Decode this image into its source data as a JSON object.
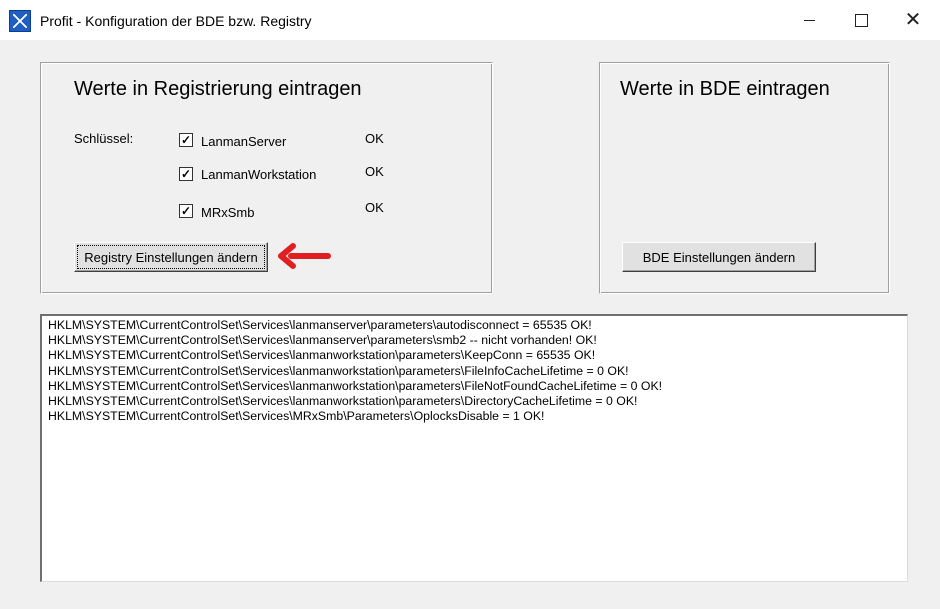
{
  "window": {
    "title": "Profit - Konfiguration der BDE bzw. Registry",
    "minimize_symbol": "—",
    "maximize_symbol": "☐",
    "close_symbol": "✕"
  },
  "registry_group": {
    "title": "Werte in Registrierung eintragen",
    "key_label": "Schlüssel:",
    "keys": [
      {
        "label": "LanmanServer",
        "checked": true,
        "status": "OK"
      },
      {
        "label": "LanmanWorkstation",
        "checked": true,
        "status": "OK"
      },
      {
        "label": "MRxSmb",
        "checked": true,
        "status": "OK"
      }
    ],
    "button_label": "Registry Einstellungen ändern"
  },
  "bde_group": {
    "title": "Werte in BDE eintragen",
    "button_label": "BDE Einstellungen ändern"
  },
  "log": {
    "lines": [
      "HKLM\\SYSTEM\\CurrentControlSet\\Services\\lanmanserver\\parameters\\autodisconnect = 65535    OK!",
      "HKLM\\SYSTEM\\CurrentControlSet\\Services\\lanmanserver\\parameters\\smb2 -- nicht vorhanden!    OK!",
      "HKLM\\SYSTEM\\CurrentControlSet\\Services\\lanmanworkstation\\parameters\\KeepConn  = 65535    OK!",
      "HKLM\\SYSTEM\\CurrentControlSet\\Services\\lanmanworkstation\\parameters\\FileInfoCacheLifetime  = 0    OK!",
      "HKLM\\SYSTEM\\CurrentControlSet\\Services\\lanmanworkstation\\parameters\\FileNotFoundCacheLifetime  = 0    OK!",
      "HKLM\\SYSTEM\\CurrentControlSet\\Services\\lanmanworkstation\\parameters\\DirectoryCacheLifetime  = 0    OK!",
      "HKLM\\SYSTEM\\CurrentControlSet\\Services\\MRxSmb\\Parameters\\OplocksDisable  = 1    OK!"
    ]
  },
  "colors": {
    "arrow": "#e02020",
    "window_bg": "#f0f0f0"
  },
  "icons": {
    "app": "profit-app-icon",
    "annotation": "red-arrow-icon"
  }
}
